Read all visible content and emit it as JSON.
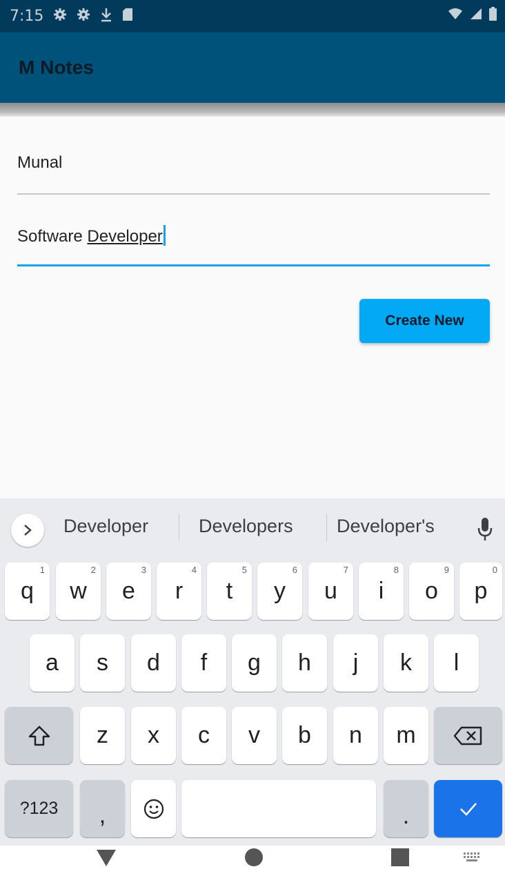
{
  "status_bar": {
    "time": "7:15",
    "icons": [
      "gear-icon",
      "gear-icon",
      "download-icon",
      "sd-card-icon",
      "wifi-icon",
      "signal-icon",
      "battery-icon"
    ]
  },
  "app_bar": {
    "title": "M Notes"
  },
  "form": {
    "name_value": "Munal",
    "description_value_prefix": "Software ",
    "description_value_composing": "Developer",
    "create_label": "Create New"
  },
  "keyboard": {
    "suggestions": [
      "Developer",
      "Developers",
      "Developer's"
    ],
    "row1": [
      "q",
      "w",
      "e",
      "r",
      "t",
      "y",
      "u",
      "i",
      "o",
      "p"
    ],
    "row1_hints": [
      "1",
      "2",
      "3",
      "4",
      "5",
      "6",
      "7",
      "8",
      "9",
      "0"
    ],
    "row2": [
      "a",
      "s",
      "d",
      "f",
      "g",
      "h",
      "j",
      "k",
      "l"
    ],
    "row3": [
      "z",
      "x",
      "c",
      "v",
      "b",
      "n",
      "m"
    ],
    "symbols_label": "?123",
    "comma_label": ",",
    "period_label": "."
  },
  "colors": {
    "app_bar": "#01527a",
    "status_bar": "#013a5a",
    "accent": "#03a9f4",
    "enter_key": "#1a73e8"
  }
}
